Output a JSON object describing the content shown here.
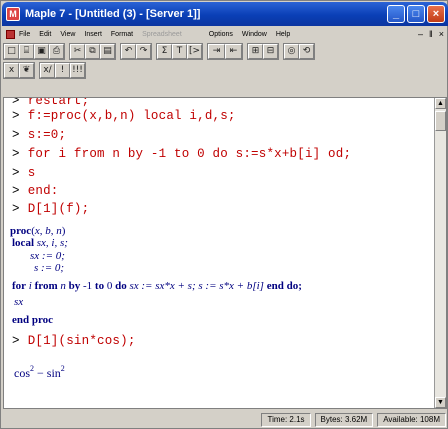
{
  "window": {
    "title": "Maple 7 - [Untitled (3) - [Server 1]]"
  },
  "menubar": {
    "items": [
      "File",
      "Edit",
      "View",
      "Insert",
      "Format",
      "Spreadsheet",
      "Options",
      "Window",
      "Help"
    ],
    "controls": [
      "–",
      "ǁ",
      "×"
    ]
  },
  "toolbar1": {
    "groups": [
      [
        "new-icon",
        "open-icon",
        "save-icon",
        "print-icon"
      ],
      [
        "cut-icon",
        "copy-icon",
        "paste-icon"
      ],
      [
        "undo-icon",
        "redo-icon"
      ],
      [
        "sigma-icon",
        "T",
        "prompt-icon"
      ],
      [
        "indent-icon",
        "outdent-icon"
      ],
      [
        "expand-icon",
        "collapse-icon"
      ],
      [
        "stop-icon",
        "restart-icon"
      ]
    ]
  },
  "toolbar2": {
    "buttons": [
      "x",
      "maple-leaf-icon",
      "x/",
      "!",
      "!!!"
    ]
  },
  "worksheet": {
    "input_lines": [
      "restart;",
      "f:=proc(x,b,n) local i,d,s;",
      "s:=0;",
      "for i from n by -1 to 0 do s:=s*x+b[i] od;",
      "s",
      "end:",
      "D[1](f);"
    ],
    "output": {
      "proc_header": "proc(x, b, n)",
      "local_label": "local",
      "local_vars": "sx, i, s;",
      "sx_assign": "sx := 0;",
      "s_assign": "s := 0;",
      "for_line_kw1": "for",
      "for_line_i": "i",
      "for_line_kw2": "from",
      "for_line_n": "n",
      "for_line_kw3": "by",
      "for_line_m1": "-1",
      "for_line_kw4": "to",
      "for_line_0": "0",
      "for_line_kw5": "do",
      "for_line_body": "sx := sx*x + s; s := s*x + b[i]",
      "for_line_kw6": "end do;",
      "sx_line": "sx",
      "end_proc": "end proc"
    },
    "input2": "D[1](sin*cos);",
    "result": {
      "a": "cos",
      "a_exp": "2",
      "minus": " − sin",
      "b_exp": "2"
    }
  },
  "statusbar": {
    "time": "Time: 2.1s",
    "bytes": "Bytes: 3.62M",
    "available": "Available: 108M"
  }
}
